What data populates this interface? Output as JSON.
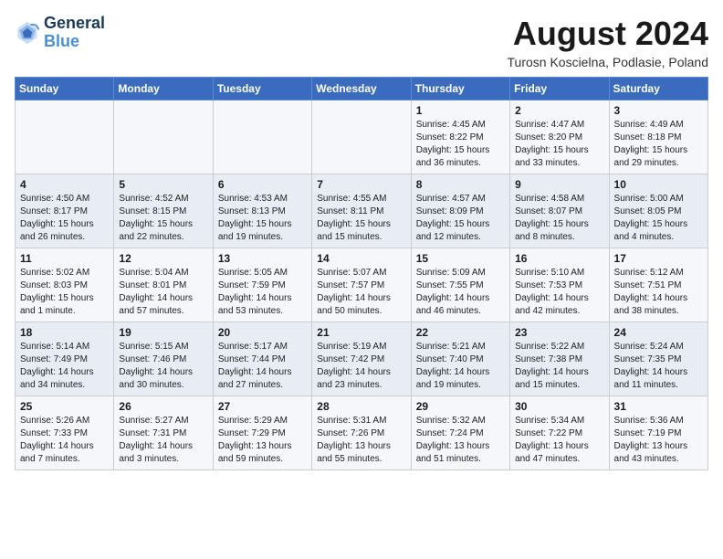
{
  "logo": {
    "text_general": "General",
    "text_blue": "Blue"
  },
  "header": {
    "month_year": "August 2024",
    "location": "Turosn Koscielna, Podlasie, Poland"
  },
  "weekdays": [
    "Sunday",
    "Monday",
    "Tuesday",
    "Wednesday",
    "Thursday",
    "Friday",
    "Saturday"
  ],
  "weeks": [
    [
      {
        "day": "",
        "info": ""
      },
      {
        "day": "",
        "info": ""
      },
      {
        "day": "",
        "info": ""
      },
      {
        "day": "",
        "info": ""
      },
      {
        "day": "1",
        "info": "Sunrise: 4:45 AM\nSunset: 8:22 PM\nDaylight: 15 hours\nand 36 minutes."
      },
      {
        "day": "2",
        "info": "Sunrise: 4:47 AM\nSunset: 8:20 PM\nDaylight: 15 hours\nand 33 minutes."
      },
      {
        "day": "3",
        "info": "Sunrise: 4:49 AM\nSunset: 8:18 PM\nDaylight: 15 hours\nand 29 minutes."
      }
    ],
    [
      {
        "day": "4",
        "info": "Sunrise: 4:50 AM\nSunset: 8:17 PM\nDaylight: 15 hours\nand 26 minutes."
      },
      {
        "day": "5",
        "info": "Sunrise: 4:52 AM\nSunset: 8:15 PM\nDaylight: 15 hours\nand 22 minutes."
      },
      {
        "day": "6",
        "info": "Sunrise: 4:53 AM\nSunset: 8:13 PM\nDaylight: 15 hours\nand 19 minutes."
      },
      {
        "day": "7",
        "info": "Sunrise: 4:55 AM\nSunset: 8:11 PM\nDaylight: 15 hours\nand 15 minutes."
      },
      {
        "day": "8",
        "info": "Sunrise: 4:57 AM\nSunset: 8:09 PM\nDaylight: 15 hours\nand 12 minutes."
      },
      {
        "day": "9",
        "info": "Sunrise: 4:58 AM\nSunset: 8:07 PM\nDaylight: 15 hours\nand 8 minutes."
      },
      {
        "day": "10",
        "info": "Sunrise: 5:00 AM\nSunset: 8:05 PM\nDaylight: 15 hours\nand 4 minutes."
      }
    ],
    [
      {
        "day": "11",
        "info": "Sunrise: 5:02 AM\nSunset: 8:03 PM\nDaylight: 15 hours\nand 1 minute."
      },
      {
        "day": "12",
        "info": "Sunrise: 5:04 AM\nSunset: 8:01 PM\nDaylight: 14 hours\nand 57 minutes."
      },
      {
        "day": "13",
        "info": "Sunrise: 5:05 AM\nSunset: 7:59 PM\nDaylight: 14 hours\nand 53 minutes."
      },
      {
        "day": "14",
        "info": "Sunrise: 5:07 AM\nSunset: 7:57 PM\nDaylight: 14 hours\nand 50 minutes."
      },
      {
        "day": "15",
        "info": "Sunrise: 5:09 AM\nSunset: 7:55 PM\nDaylight: 14 hours\nand 46 minutes."
      },
      {
        "day": "16",
        "info": "Sunrise: 5:10 AM\nSunset: 7:53 PM\nDaylight: 14 hours\nand 42 minutes."
      },
      {
        "day": "17",
        "info": "Sunrise: 5:12 AM\nSunset: 7:51 PM\nDaylight: 14 hours\nand 38 minutes."
      }
    ],
    [
      {
        "day": "18",
        "info": "Sunrise: 5:14 AM\nSunset: 7:49 PM\nDaylight: 14 hours\nand 34 minutes."
      },
      {
        "day": "19",
        "info": "Sunrise: 5:15 AM\nSunset: 7:46 PM\nDaylight: 14 hours\nand 30 minutes."
      },
      {
        "day": "20",
        "info": "Sunrise: 5:17 AM\nSunset: 7:44 PM\nDaylight: 14 hours\nand 27 minutes."
      },
      {
        "day": "21",
        "info": "Sunrise: 5:19 AM\nSunset: 7:42 PM\nDaylight: 14 hours\nand 23 minutes."
      },
      {
        "day": "22",
        "info": "Sunrise: 5:21 AM\nSunset: 7:40 PM\nDaylight: 14 hours\nand 19 minutes."
      },
      {
        "day": "23",
        "info": "Sunrise: 5:22 AM\nSunset: 7:38 PM\nDaylight: 14 hours\nand 15 minutes."
      },
      {
        "day": "24",
        "info": "Sunrise: 5:24 AM\nSunset: 7:35 PM\nDaylight: 14 hours\nand 11 minutes."
      }
    ],
    [
      {
        "day": "25",
        "info": "Sunrise: 5:26 AM\nSunset: 7:33 PM\nDaylight: 14 hours\nand 7 minutes."
      },
      {
        "day": "26",
        "info": "Sunrise: 5:27 AM\nSunset: 7:31 PM\nDaylight: 14 hours\nand 3 minutes."
      },
      {
        "day": "27",
        "info": "Sunrise: 5:29 AM\nSunset: 7:29 PM\nDaylight: 13 hours\nand 59 minutes."
      },
      {
        "day": "28",
        "info": "Sunrise: 5:31 AM\nSunset: 7:26 PM\nDaylight: 13 hours\nand 55 minutes."
      },
      {
        "day": "29",
        "info": "Sunrise: 5:32 AM\nSunset: 7:24 PM\nDaylight: 13 hours\nand 51 minutes."
      },
      {
        "day": "30",
        "info": "Sunrise: 5:34 AM\nSunset: 7:22 PM\nDaylight: 13 hours\nand 47 minutes."
      },
      {
        "day": "31",
        "info": "Sunrise: 5:36 AM\nSunset: 7:19 PM\nDaylight: 13 hours\nand 43 minutes."
      }
    ]
  ]
}
